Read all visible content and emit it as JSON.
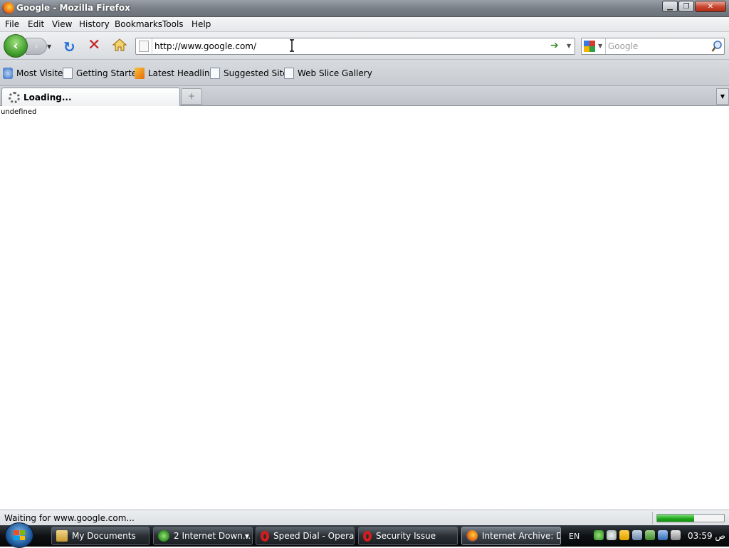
{
  "window": {
    "title": "Google - Mozilla Firefox",
    "minimize_label": "▁",
    "maximize_label": "❐",
    "close_label": "✕"
  },
  "menu": {
    "items": [
      "File",
      "Edit",
      "View",
      "History",
      "Bookmarks",
      "Tools",
      "Help"
    ]
  },
  "navbar": {
    "back_glyph": "‹",
    "forward_glyph": "›",
    "dropdown_glyph": "▼",
    "reload_glyph": "↻",
    "stop_glyph": "✕",
    "url": "http://www.google.com/",
    "go_glyph": "➔",
    "search_placeholder": "Google"
  },
  "bookmarks": [
    {
      "label": "Most Visited",
      "icon": "most-visited-icon"
    },
    {
      "label": "Getting Started",
      "icon": "page-icon"
    },
    {
      "label": "Latest Headlines",
      "icon": "rss-icon"
    },
    {
      "label": "Suggested Sites",
      "icon": "page-icon"
    },
    {
      "label": "Web Slice Gallery",
      "icon": "page-icon"
    }
  ],
  "tabs": {
    "active_label": "Loading...",
    "new_tab_glyph": "+",
    "list_glyph": "▼"
  },
  "content": {
    "text": "undefined"
  },
  "status": {
    "text": "Waiting for www.google.com...",
    "progress": 0.55
  },
  "taskbar": {
    "items": [
      {
        "label": "My Documents",
        "icon": "folder-icon"
      },
      {
        "label": "2 Internet Down...",
        "icon": "download-icon"
      },
      {
        "label": "Speed Dial - Opera",
        "icon": "opera-icon"
      },
      {
        "label": "Security Issue",
        "icon": "opera-icon"
      },
      {
        "label": "Internet Archive: D...",
        "icon": "firefox-icon"
      }
    ],
    "language": "EN",
    "clock": "03:59 ص"
  },
  "colors": {
    "progress_fill": "#1ea51a",
    "stop_red": "#c11f1f",
    "reload_blue": "#2370d8"
  }
}
